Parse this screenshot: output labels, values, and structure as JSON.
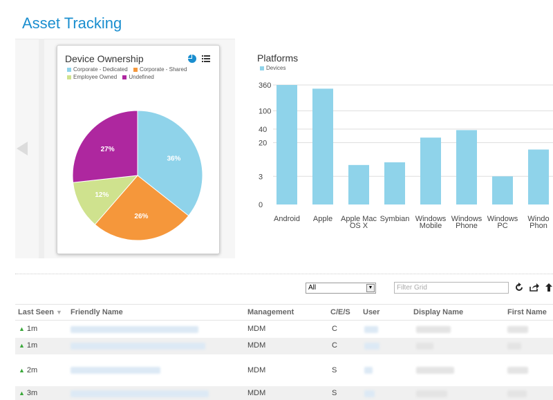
{
  "page": {
    "title": "Asset Tracking"
  },
  "ownership": {
    "title": "Device Ownership",
    "legend": [
      {
        "label": "Corporate - Dedicated",
        "color": "#8fd3ea"
      },
      {
        "label": "Corporate - Shared",
        "color": "#f5973b"
      },
      {
        "label": "Employee Owned",
        "color": "#cfe28e"
      },
      {
        "label": "Undefined",
        "color": "#ae279f"
      }
    ],
    "icons": [
      "pie-chart-icon",
      "list-icon"
    ]
  },
  "platforms": {
    "title": "Platforms",
    "legend_label": "Devices",
    "bar_color": "#8fd3ea"
  },
  "chart_data": [
    {
      "type": "pie",
      "title": "Device Ownership",
      "labels": [
        "Corporate - Dedicated",
        "Corporate - Shared",
        "Employee Owned",
        "Undefined"
      ],
      "values": [
        36,
        26,
        12,
        27
      ],
      "value_labels": [
        "36%",
        "26%",
        "12%",
        "27%"
      ],
      "colors": [
        "#8fd3ea",
        "#f5973b",
        "#cfe28e",
        "#ae279f"
      ]
    },
    {
      "type": "bar",
      "title": "Platforms",
      "series": [
        {
          "name": "Devices"
        }
      ],
      "categories": [
        "Android",
        "Apple",
        "Apple Mac OS X",
        "Symbian",
        "Windows Mobile",
        "Windows Phone",
        "Windows PC",
        "Windows Phone"
      ],
      "category_lines": [
        [
          "Android"
        ],
        [
          "Apple"
        ],
        [
          "Apple Mac",
          "OS X"
        ],
        [
          "Symbian"
        ],
        [
          "Windows",
          "Mobile"
        ],
        [
          "Windows",
          "Phone"
        ],
        [
          "Windows",
          "PC"
        ],
        [
          "Windo",
          "Phon"
        ]
      ],
      "values": [
        360,
        300,
        6,
        7,
        26,
        38,
        3,
        14
      ],
      "yticks": [
        "360",
        "100",
        "40",
        "20",
        "3",
        "0"
      ],
      "scale": "log"
    }
  ],
  "toolbar": {
    "select_value": "All",
    "filter_placeholder": "Filter Grid",
    "icons": [
      "refresh-icon",
      "export-icon",
      "upload-icon"
    ]
  },
  "grid": {
    "columns": [
      "Last Seen",
      "Friendly Name",
      "Management",
      "C/E/S",
      "User",
      "Display Name",
      "First Name"
    ],
    "rows": [
      {
        "last_seen": "1m",
        "management": "MDM",
        "ces": "C"
      },
      {
        "last_seen": "1m",
        "management": "MDM",
        "ces": "C"
      },
      {
        "last_seen": "2m",
        "management": "MDM",
        "ces": "S"
      },
      {
        "last_seen": "3m",
        "management": "MDM",
        "ces": "S"
      }
    ]
  }
}
